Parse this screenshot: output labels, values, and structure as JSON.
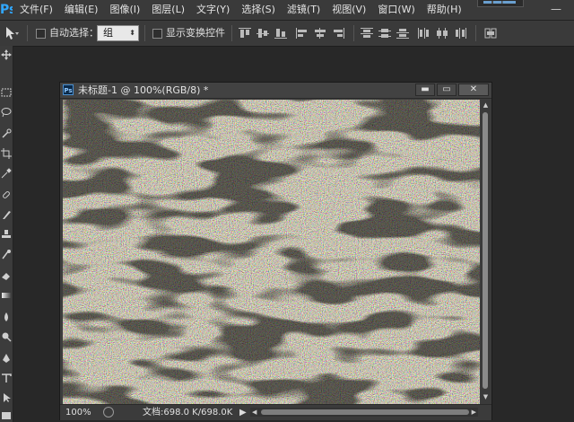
{
  "app": {
    "logo_text": "Ps"
  },
  "menu": {
    "items": [
      {
        "label": "文件(F)",
        "name": "menu-file"
      },
      {
        "label": "编辑(E)",
        "name": "menu-edit"
      },
      {
        "label": "图像(I)",
        "name": "menu-image"
      },
      {
        "label": "图层(L)",
        "name": "menu-layer"
      },
      {
        "label": "文字(Y)",
        "name": "menu-type"
      },
      {
        "label": "选择(S)",
        "name": "menu-select"
      },
      {
        "label": "滤镜(T)",
        "name": "menu-filter"
      },
      {
        "label": "视图(V)",
        "name": "menu-view"
      },
      {
        "label": "窗口(W)",
        "name": "menu-window"
      },
      {
        "label": "帮助(H)",
        "name": "menu-help"
      }
    ],
    "window_controls": {
      "minimize": "—"
    }
  },
  "options": {
    "auto_select_label": "自动选择：",
    "auto_select_checked": false,
    "auto_select_target": "组",
    "show_transform_label": "显示变换控件",
    "show_transform_checked": false
  },
  "document": {
    "badge": "Ps",
    "title": "未标题-1 @ 100%(RGB/8) *",
    "controls": {
      "minimize": "▬",
      "maximize": "▭",
      "close": "✕"
    },
    "zoom": "100%",
    "doc_info": "文档:698.0 K/698.0K"
  },
  "colors": {
    "accent": "#31a8ff",
    "chrome": "#3a3a3a",
    "workspace": "#282828",
    "noise_palette": [
      "#e8d24a",
      "#d94a7a",
      "#3a8ad8",
      "#4ac86a",
      "#c86ad8",
      "#f0f0f0",
      "#2a2a2a",
      "#e87a2a"
    ]
  }
}
